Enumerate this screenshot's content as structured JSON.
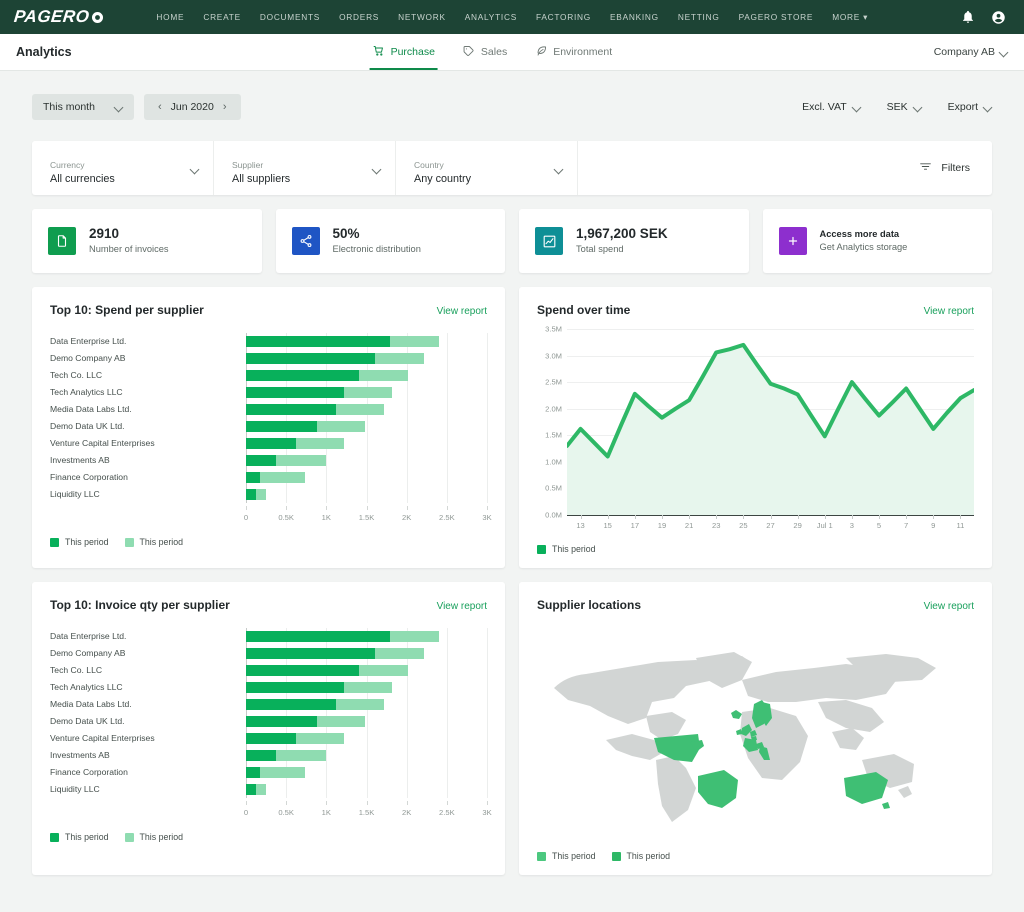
{
  "brand": {
    "logo_text": "PAGERO",
    "green": "#08b05b",
    "light_green": "#8fdcb1",
    "navy": "#1d4435"
  },
  "topnav": {
    "items": [
      {
        "label": "HOME"
      },
      {
        "label": "CREATE"
      },
      {
        "label": "DOCUMENTS"
      },
      {
        "label": "ORDERS"
      },
      {
        "label": "NETWORK"
      },
      {
        "label": "ANALYTICS"
      },
      {
        "label": "FACTORING"
      },
      {
        "label": "EBANKING"
      },
      {
        "label": "NETTING"
      },
      {
        "label": "PAGERO STORE"
      },
      {
        "label": "MORE ▾"
      }
    ],
    "icons": [
      "bell-icon",
      "user-avatar-icon"
    ]
  },
  "subheader": {
    "title": "Analytics",
    "tabs": [
      {
        "label": "Purchase",
        "icon": "shopping-cart-icon",
        "active": true
      },
      {
        "label": "Sales",
        "icon": "price-tag-icon",
        "active": false
      },
      {
        "label": "Environment",
        "icon": "leaf-icon",
        "active": false
      }
    ],
    "company": "Company AB"
  },
  "toolbar": {
    "period": "This month",
    "date": "Jun 2020",
    "prev": "‹",
    "next": "›",
    "vat": "Excl. VAT",
    "currency": "SEK",
    "export": "Export"
  },
  "filters": {
    "cells": [
      {
        "label": "Currency",
        "value": "All currencies"
      },
      {
        "label": "Supplier",
        "value": "All suppliers"
      },
      {
        "label": "Country",
        "value": "Any country"
      }
    ],
    "button": "Filters",
    "button_icon": "filter-icon"
  },
  "kpis": [
    {
      "value": "2910",
      "caption": "Number of invoices",
      "icon": "document-icon",
      "color": "#0f9d4f"
    },
    {
      "value": "50%",
      "caption": "Electronic distribution",
      "icon": "share-nodes-icon",
      "color": "#1f55c4"
    },
    {
      "value": "1,967,200 SEK",
      "caption": "Total spend",
      "icon": "chart-line-icon",
      "color": "#0e8f96"
    },
    {
      "value": "Access more data",
      "caption": "Get Analytics storage",
      "icon": "plus-icon",
      "color": "#8d2fce",
      "promo": true
    }
  ],
  "cards": {
    "spend_per_supplier": {
      "title": "Top 10: Spend per supplier",
      "link": "View report"
    },
    "spend_over_time": {
      "title": "Spend over time",
      "link": "View report"
    },
    "invoice_qty": {
      "title": "Top 10: Invoice qty per supplier",
      "link": "View report"
    },
    "supplier_locations": {
      "title": "Supplier locations",
      "link": "View report"
    }
  },
  "legends": {
    "two": [
      {
        "label": "This period",
        "color": "#08b05b"
      },
      {
        "label": "This period",
        "color": "#8fdcb1"
      }
    ],
    "one": [
      {
        "label": "This period",
        "color": "#08b05b"
      }
    ],
    "map": [
      {
        "label": "This period",
        "color": "#4cc87f"
      },
      {
        "label": "This period",
        "color": "#2eb866"
      }
    ]
  },
  "chart_data": [
    {
      "type": "bar",
      "id": "spend-per-supplier",
      "title": "Top 10: Spend per supplier",
      "orientation": "horizontal",
      "stacked": true,
      "categories": [
        "Data Enterprise Ltd.",
        "Demo Company AB",
        "Tech Co. LLC",
        "Tech Analytics LLC",
        "Media Data Labs Ltd.",
        "Demo Data UK Ltd.",
        "Venture Capital Enterprises",
        "Investments AB",
        "Finance Corporation",
        "Liquidity LLC"
      ],
      "series": [
        {
          "name": "This period",
          "color": "#08b05b",
          "values": [
            1790,
            1610,
            1410,
            1220,
            1120,
            880,
            620,
            370,
            175,
            125
          ]
        },
        {
          "name": "This period",
          "color": "#8fdcb1",
          "values": [
            610,
            610,
            610,
            600,
            600,
            600,
            600,
            620,
            560,
            130
          ]
        }
      ],
      "xticks": [
        0,
        0.5,
        1,
        1.5,
        2,
        2.5,
        3
      ],
      "xtick_labels": [
        "0",
        "0.5K",
        "1K",
        "1.5K",
        "2K",
        "2.5K",
        "3K"
      ],
      "xlim": [
        0,
        3000
      ],
      "xlabel": "",
      "ylabel": "",
      "grid": true,
      "legend_position": "bottom-left"
    },
    {
      "type": "bar",
      "id": "invoice-qty-per-supplier",
      "title": "Top 10: Invoice qty per supplier",
      "orientation": "horizontal",
      "stacked": true,
      "categories": [
        "Data Enterprise Ltd.",
        "Demo Company AB",
        "Tech Co. LLC",
        "Tech Analytics LLC",
        "Media Data Labs Ltd.",
        "Demo Data UK Ltd.",
        "Venture Capital Enterprises",
        "Investments AB",
        "Finance Corporation",
        "Liquidity LLC"
      ],
      "series": [
        {
          "name": "This period",
          "color": "#08b05b",
          "values": [
            1790,
            1610,
            1410,
            1220,
            1120,
            880,
            620,
            370,
            175,
            125
          ]
        },
        {
          "name": "This period",
          "color": "#8fdcb1",
          "values": [
            610,
            610,
            610,
            600,
            600,
            600,
            600,
            620,
            560,
            130
          ]
        }
      ],
      "xticks": [
        0,
        0.5,
        1,
        1.5,
        2,
        2.5,
        3
      ],
      "xtick_labels": [
        "0",
        "0.5K",
        "1K",
        "1.5K",
        "2K",
        "2.5K",
        "3K"
      ],
      "xlim": [
        0,
        3000
      ],
      "xlabel": "",
      "ylabel": "",
      "grid": true,
      "legend_position": "bottom-left"
    },
    {
      "type": "area",
      "id": "spend-over-time",
      "title": "Spend over time",
      "x": [
        "12",
        "13",
        "14",
        "15",
        "16",
        "17",
        "18",
        "19",
        "20",
        "21",
        "22",
        "23",
        "24",
        "25",
        "26",
        "27",
        "28",
        "29",
        "30",
        "Jul 1",
        "2",
        "3",
        "4",
        "5",
        "6",
        "7",
        "8",
        "9",
        "10",
        "11",
        "12"
      ],
      "xtick_labels": [
        "13",
        "15",
        "17",
        "19",
        "21",
        "23",
        "25",
        "27",
        "29",
        "Jul 1",
        "3",
        "5",
        "7",
        "9",
        "11"
      ],
      "series": [
        {
          "name": "This period",
          "color": "#2eb866",
          "values": [
            1.3,
            1.62,
            1.36,
            1.1,
            1.7,
            2.28,
            2.05,
            1.83,
            2.0,
            2.16,
            2.6,
            3.06,
            3.12,
            3.2,
            2.83,
            2.47,
            2.38,
            2.27,
            1.87,
            1.48,
            2.0,
            2.5,
            2.18,
            1.87,
            2.12,
            2.38,
            2.0,
            1.62,
            1.92,
            2.2,
            2.35
          ]
        }
      ],
      "ylim": [
        0,
        3.5
      ],
      "yticks": [
        0,
        0.5,
        1.0,
        1.5,
        2.0,
        2.5,
        3.0,
        3.5
      ],
      "ytick_labels": [
        "0.0M",
        "0.5M",
        "1.0M",
        "1.5M",
        "2.0M",
        "2.5M",
        "3.0M",
        "3.5M"
      ],
      "xlabel": "",
      "ylabel": "",
      "grid": true,
      "legend_position": "bottom-left"
    },
    {
      "type": "map",
      "id": "supplier-locations",
      "title": "Supplier locations",
      "highlighted_regions": [
        "United States",
        "Brazil",
        "Iceland",
        "United Kingdom",
        "Ireland",
        "Norway",
        "Sweden",
        "Netherlands",
        "Belgium",
        "France",
        "Switzerland",
        "Italy",
        "Australia"
      ],
      "base_color": "#d2d5d4",
      "highlight_color": "#3fbf74"
    }
  ]
}
